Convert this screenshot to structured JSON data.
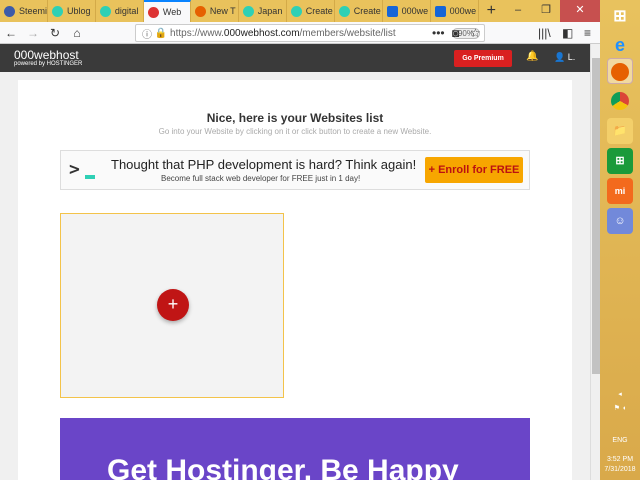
{
  "tabs": [
    {
      "label": "Steemi",
      "color": "#3d5ba8"
    },
    {
      "label": "Ublog",
      "color": "#2fd0b5"
    },
    {
      "label": "digital",
      "color": "#2fd0b5"
    },
    {
      "label": "Web",
      "color": "#d33",
      "active": true
    },
    {
      "label": "New T",
      "color": "#e66000"
    },
    {
      "label": "Japan",
      "color": "#2fd0b5"
    },
    {
      "label": "Create",
      "color": "#2fd0b5"
    },
    {
      "label": "Create",
      "color": "#2fd0b5"
    },
    {
      "label": "000we",
      "color": "#1565d8"
    },
    {
      "label": "000we",
      "color": "#1565d8"
    }
  ],
  "nav": {
    "url_prefix": "https://www.",
    "url_domain": "000webhost.com",
    "url_path": "/members/website/list",
    "zoom": "90%"
  },
  "site": {
    "logo": "000webhost",
    "logo_sub": "powered by HOSTINGER",
    "premium": "Go Premium",
    "user": "L."
  },
  "main": {
    "title": "Nice, here is your Websites list",
    "subtitle": "Go into your Website by clicking on it or click button to create a new Website.",
    "promo_title": "Thought that PHP development is hard? Think again!",
    "promo_sub": "Become full stack web developer for FREE just in 1 day!",
    "enroll": "+ Enroll for FREE",
    "add_icon": "+",
    "banner": "Get Hostinger. Be Happy"
  },
  "tray": {
    "lang": "ENG",
    "time": "3:52 PM",
    "date": "7/31/2018"
  }
}
